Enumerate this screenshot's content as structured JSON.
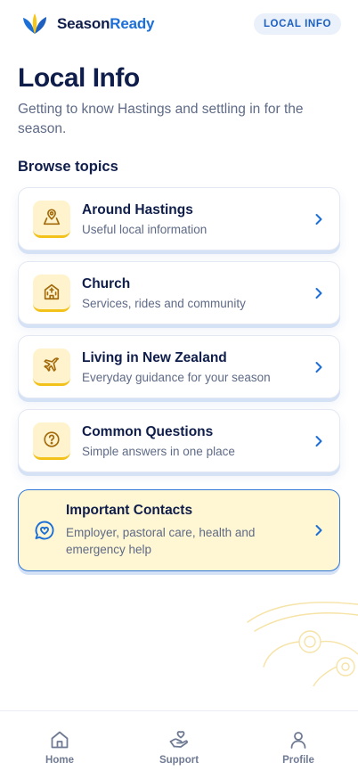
{
  "header": {
    "brand_part1": "Season",
    "brand_part2": "Ready",
    "badge": "LOCAL INFO"
  },
  "page": {
    "title": "Local Info",
    "subtitle": "Getting to know Hastings and settling in for the season.",
    "section_heading": "Browse topics"
  },
  "topics": [
    {
      "title": "Around Hastings",
      "desc": "Useful local information",
      "icon": "map-pin-icon"
    },
    {
      "title": "Church",
      "desc": "Services, rides and community",
      "icon": "church-icon"
    },
    {
      "title": "Living in New Zealand",
      "desc": "Everyday guidance for your season",
      "icon": "airplane-icon"
    },
    {
      "title": "Common Questions",
      "desc": "Simple answers in one place",
      "icon": "question-icon"
    }
  ],
  "contacts": {
    "title": "Important Contacts",
    "desc": "Employer, pastoral care, health and emergency help",
    "icon": "heart-chat-icon"
  },
  "nav": [
    {
      "label": "Home",
      "icon": "home-icon"
    },
    {
      "label": "Support",
      "icon": "support-hand-icon"
    },
    {
      "label": "Profile",
      "icon": "person-icon"
    }
  ],
  "colors": {
    "navy": "#0f1d4a",
    "accent_blue": "#1b6fd6",
    "gold": "#f2c21b",
    "icon_bg": "#fff3cd",
    "muted_text": "#5e6a86"
  }
}
